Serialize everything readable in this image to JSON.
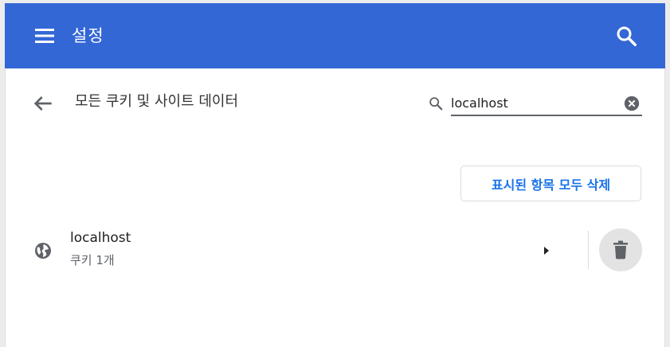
{
  "header": {
    "title": "설정",
    "menu_icon": "menu-icon",
    "search_icon": "search-icon",
    "color": "#3367d6"
  },
  "page": {
    "title": "모든 쿠키 및 사이트 데이터",
    "back_icon": "arrow-back-icon"
  },
  "search": {
    "value": "localhost",
    "icon": "search-icon",
    "clear_icon": "clear-icon"
  },
  "actions": {
    "remove_all_label": "표시된 항목 모두 삭제",
    "accent_color": "#1a73e8"
  },
  "sites": [
    {
      "name": "localhost",
      "detail": "쿠키 1개",
      "icon": "globe-icon",
      "expand_icon": "chevron-right-icon",
      "delete_icon": "trash-icon"
    }
  ]
}
